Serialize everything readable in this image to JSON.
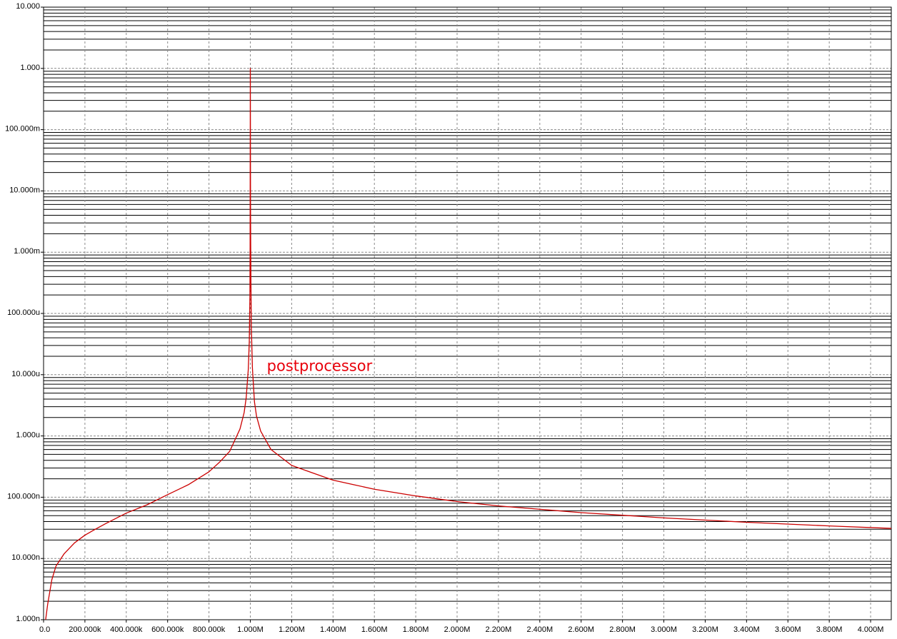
{
  "chart_data": {
    "type": "line",
    "title": "",
    "xlabel": "",
    "ylabel": "",
    "xscale": "linear",
    "yscale": "log",
    "xlim": [
      0,
      4100000
    ],
    "ylim": [
      1e-09,
      10
    ],
    "grid": true,
    "x_tick_labels": [
      "0.0",
      "200.000k",
      "400.000k",
      "600.000k",
      "800.000k",
      "1.000M",
      "1.200M",
      "1.400M",
      "1.600M",
      "1.800M",
      "2.000M",
      "2.200M",
      "2.400M",
      "2.600M",
      "2.800M",
      "3.000M",
      "3.200M",
      "3.400M",
      "3.600M",
      "3.800M",
      "4.000M"
    ],
    "x_tick_values": [
      0,
      200000,
      400000,
      600000,
      800000,
      1000000,
      1200000,
      1400000,
      1600000,
      1800000,
      2000000,
      2200000,
      2400000,
      2600000,
      2800000,
      3000000,
      3200000,
      3400000,
      3600000,
      3800000,
      4000000
    ],
    "y_tick_labels": [
      "1.000n",
      "10.000n",
      "100.000n",
      "1.000u",
      "10.000u",
      "100.000u",
      "1.000m",
      "10.000m",
      "100.000m",
      "1.000",
      "10.000"
    ],
    "y_tick_values": [
      1e-09,
      1e-08,
      1e-07,
      1e-06,
      1e-05,
      0.0001,
      0.001,
      0.01,
      0.1,
      1,
      10
    ],
    "annotations": [
      {
        "text": "postprocessor",
        "color": "#e8000b"
      }
    ],
    "series": [
      {
        "color": "#cc0000",
        "x": [
          10000,
          20000,
          40000,
          60000,
          100000,
          150000,
          200000,
          250000,
          300000,
          400000,
          500000,
          600000,
          700000,
          800000,
          850000,
          900000,
          950000,
          970000,
          980000,
          990000,
          995000,
          998000,
          999000,
          1000000,
          1001000,
          1002000,
          1003000,
          1005000,
          1010000,
          1020000,
          1030000,
          1050000,
          1100000,
          1200000,
          1300000,
          1400000,
          1500000,
          1600000,
          1800000,
          2000000,
          2200000,
          2600000,
          3000000,
          3400000,
          3800000,
          4100000
        ],
        "y": [
          1e-09,
          1.8e-09,
          4.5e-09,
          7.5e-09,
          1.2e-08,
          1.8e-08,
          2.4e-08,
          3e-08,
          3.7e-08,
          5.5e-08,
          7.5e-08,
          1.1e-07,
          1.6e-07,
          2.6e-07,
          3.7e-07,
          5.6e-07,
          1.3e-06,
          2.4e-06,
          4.2e-06,
          1.2e-05,
          3.5e-05,
          0.0002,
          0.0012,
          1.0,
          0.005,
          0.001,
          0.0003,
          6e-05,
          1.3e-05,
          3.6e-06,
          2.1e-06,
          1.2e-06,
          6e-07,
          3.3e-07,
          2.5e-07,
          1.9e-07,
          1.6e-07,
          1.35e-07,
          1.05e-07,
          8.5e-08,
          7.2e-08,
          5.6e-08,
          4.6e-08,
          3.9e-08,
          3.4e-08,
          3.1e-08
        ]
      }
    ]
  }
}
